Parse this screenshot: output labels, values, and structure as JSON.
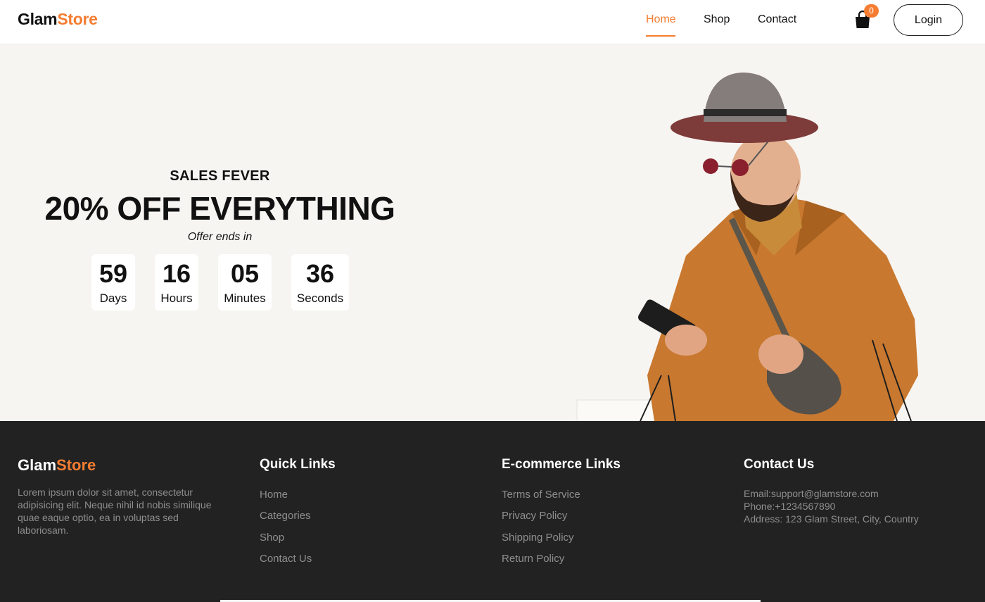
{
  "brand": {
    "part1": "Glam",
    "part2": "Store"
  },
  "nav": {
    "links": [
      {
        "label": "Home",
        "active": true
      },
      {
        "label": "Shop",
        "active": false
      },
      {
        "label": "Contact",
        "active": false
      }
    ],
    "cart_count": "0",
    "cart_icon": "shopping-bag-icon",
    "login_label": "Login"
  },
  "hero": {
    "subtitle": "SALES FEVER",
    "title": "20% OFF EVERYTHING",
    "offer_text": "Offer ends in",
    "countdown": [
      {
        "value": "59",
        "unit": "Days"
      },
      {
        "value": "16",
        "unit": "Hours"
      },
      {
        "value": "05",
        "unit": "Minutes"
      },
      {
        "value": "36",
        "unit": "Seconds"
      }
    ]
  },
  "footer": {
    "brand": {
      "part1": "Glam",
      "part2": "Store"
    },
    "description": "Lorem ipsum dolor sit amet, consectetur adipisicing elit. Neque nihil id nobis similique quae eaque optio, ea in voluptas sed laboriosam.",
    "quick_links": {
      "heading": "Quick Links",
      "items": [
        "Home",
        "Categories",
        "Shop",
        "Contact Us"
      ]
    },
    "ecommerce_links": {
      "heading": "E-commerce Links",
      "items": [
        "Terms of Service",
        "Privacy Policy",
        "Shipping Policy",
        "Return Policy"
      ]
    },
    "contact": {
      "heading": "Contact Us",
      "email": "Email:support@glamstore.com",
      "phone": "Phone:+1234567890",
      "address": "Address: 123 Glam Street, City, Country"
    }
  },
  "colors": {
    "accent": "#f47d31",
    "footer_bg": "#222222",
    "hero_bg": "#f7f5f2"
  }
}
